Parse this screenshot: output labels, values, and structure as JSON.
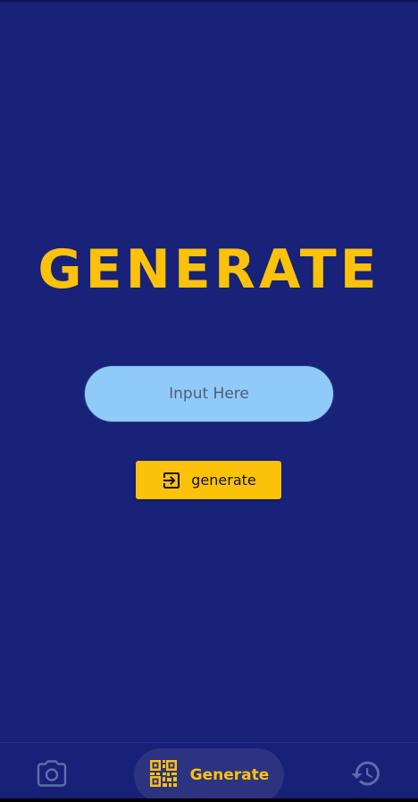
{
  "page": {
    "title": "GENERATE"
  },
  "input": {
    "placeholder": "Input Here",
    "value": ""
  },
  "generate_button": {
    "label": "generate",
    "icon": "exit-to-app-icon"
  },
  "bottom_nav": {
    "items": [
      {
        "id": "scan",
        "icon": "camera-icon",
        "label": "",
        "active": false
      },
      {
        "id": "generate",
        "icon": "qr-code-icon",
        "label": "Generate",
        "active": true
      },
      {
        "id": "history",
        "icon": "history-icon",
        "label": "",
        "active": false
      }
    ]
  },
  "colors": {
    "background": "#182279",
    "accent": "#fcc20a",
    "input_fill": "#90caf9",
    "inactive_icon": "#5a6fa8"
  }
}
